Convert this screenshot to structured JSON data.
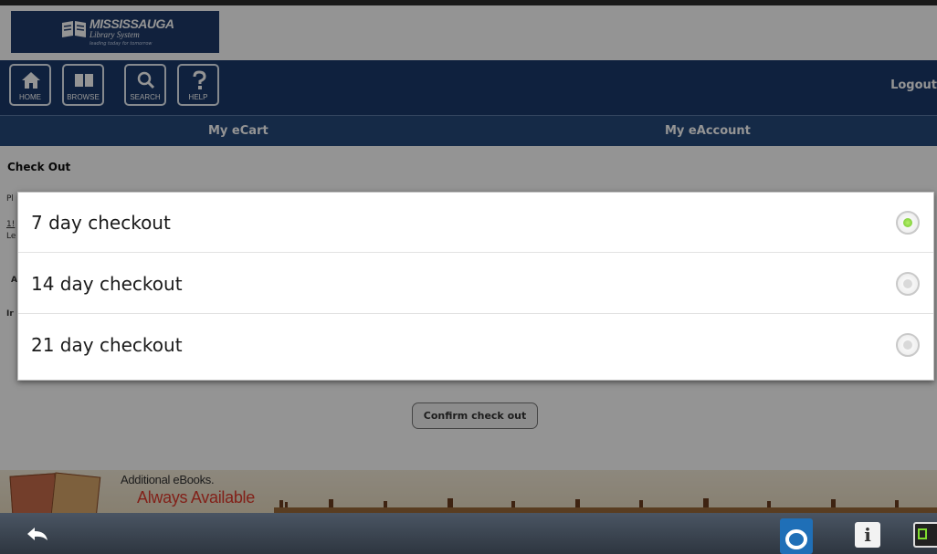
{
  "logo": {
    "name": "MISSISSAUGA",
    "sub": "Library System",
    "tag": "leading today for tomorrow"
  },
  "nav": {
    "home": "HOME",
    "browse": "BROWSE",
    "search": "SEARCH",
    "help": "HELP",
    "logout": "Logout"
  },
  "subnav": {
    "cart": "My eCart",
    "account": "My eAccount"
  },
  "page": {
    "title": "Check Out",
    "peek": [
      "Pl",
      "1!",
      "Le",
      "A",
      "Ir"
    ],
    "confirm_label": "Confirm check out"
  },
  "banner": {
    "line1": "Additional eBooks.",
    "line2": "Always Available"
  },
  "dialog": {
    "options": [
      {
        "label": "7 day checkout",
        "selected": true
      },
      {
        "label": "14 day checkout",
        "selected": false
      },
      {
        "label": "21 day checkout",
        "selected": false
      }
    ]
  },
  "colors": {
    "nav_blue": "#1b3a6b",
    "subnav_blue": "#25497b",
    "radio_green": "#6fc52a"
  }
}
